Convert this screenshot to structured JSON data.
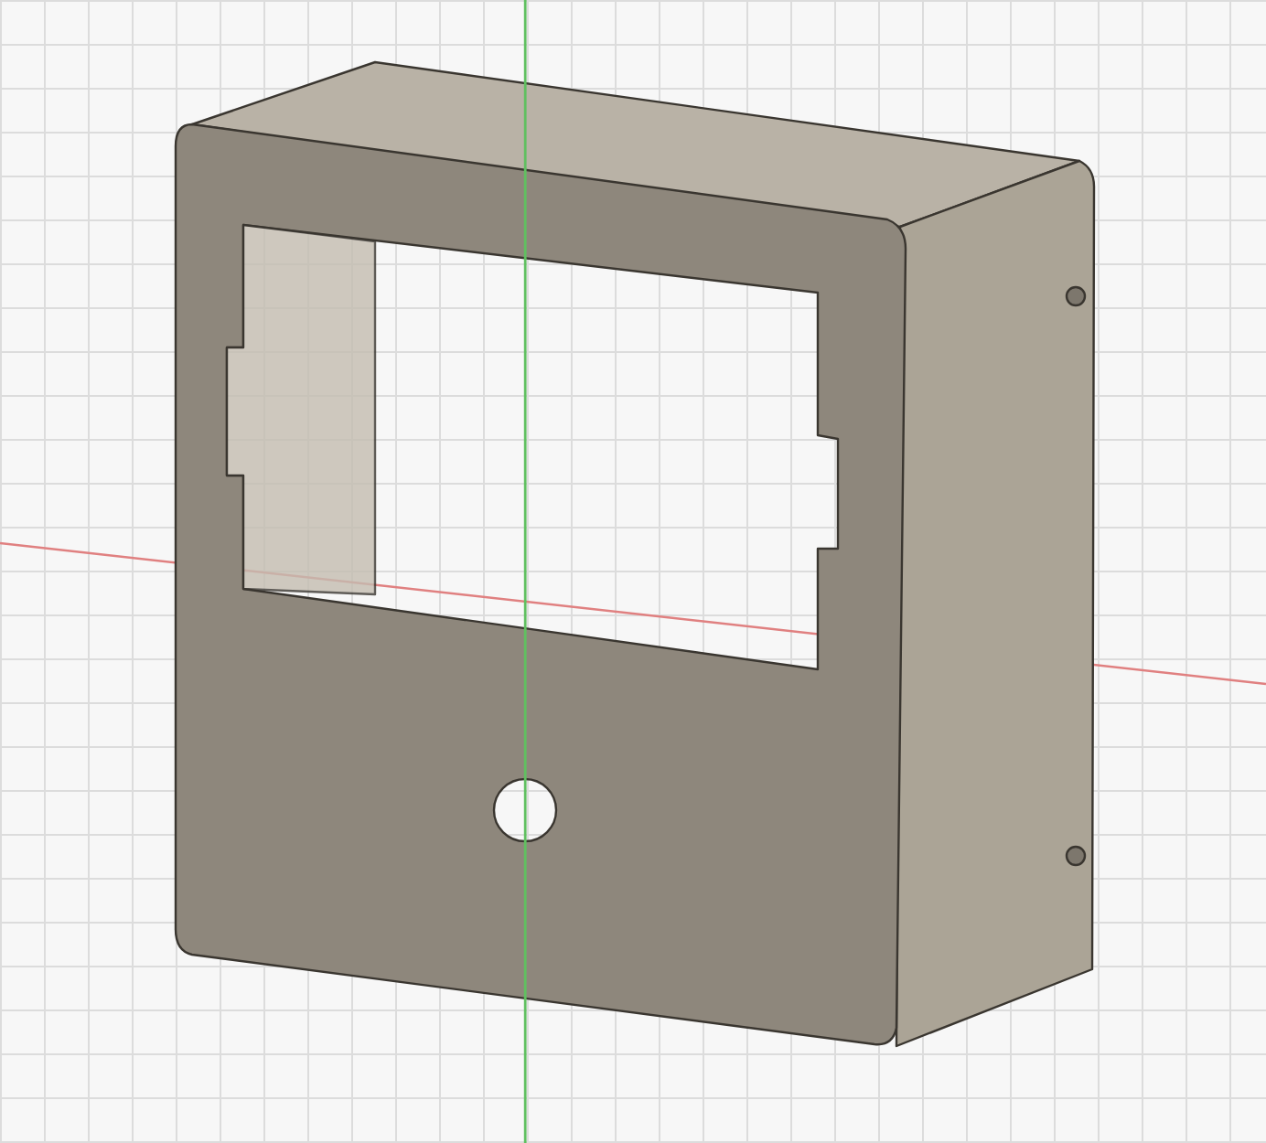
{
  "viewport": {
    "axes": [
      {
        "kind": "x",
        "color": "#e08080"
      },
      {
        "kind": "y",
        "color": "#60c060"
      }
    ]
  }
}
